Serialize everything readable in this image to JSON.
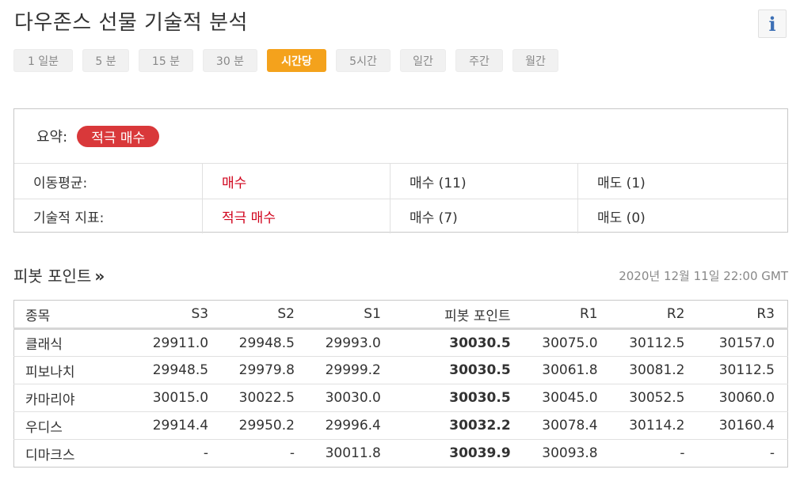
{
  "title": "다우존스 선물 기술적 분석",
  "info_icon": "info-icon",
  "timeframe_tabs": [
    {
      "label": "1 일분",
      "active": false
    },
    {
      "label": "5 분",
      "active": false
    },
    {
      "label": "15 분",
      "active": false
    },
    {
      "label": "30 분",
      "active": false
    },
    {
      "label": "시간당",
      "active": true
    },
    {
      "label": "5시간",
      "active": false
    },
    {
      "label": "일간",
      "active": false
    },
    {
      "label": "주간",
      "active": false
    },
    {
      "label": "월간",
      "active": false
    }
  ],
  "summary": {
    "label": "요약:",
    "badge": "적극 매수",
    "rows": [
      {
        "label": "이동평균:",
        "signal": "매수",
        "buy": "매수 (11)",
        "sell": "매도 (1)"
      },
      {
        "label": "기술적 지표:",
        "signal": "적극 매수",
        "buy": "매수 (7)",
        "sell": "매도 (0)"
      }
    ]
  },
  "pivot": {
    "title": "피봇 포인트",
    "arrow": "»",
    "timestamp": "2020년 12월 11일 22:00 GMT",
    "columns": [
      "종목",
      "S3",
      "S2",
      "S1",
      "피봇 포인트",
      "R1",
      "R2",
      "R3"
    ],
    "rows": [
      [
        "클래식",
        "29911.0",
        "29948.5",
        "29993.0",
        "30030.5",
        "30075.0",
        "30112.5",
        "30157.0"
      ],
      [
        "피보나치",
        "29948.5",
        "29979.8",
        "29999.2",
        "30030.5",
        "30061.8",
        "30081.2",
        "30112.5"
      ],
      [
        "카마리야",
        "30015.0",
        "30022.5",
        "30030.0",
        "30030.5",
        "30045.0",
        "30052.5",
        "30060.0"
      ],
      [
        "우디스",
        "29914.4",
        "29950.2",
        "29996.4",
        "30032.2",
        "30078.4",
        "30114.2",
        "30160.4"
      ],
      [
        "디마크스",
        "-",
        "-",
        "30011.8",
        "30039.9",
        "30093.8",
        "-",
        "-"
      ]
    ]
  },
  "colors": {
    "accent": "#f4a21c",
    "strong_buy": "#d9383a",
    "signal_text": "#d0021b",
    "info_icon": "#3c6fb5"
  }
}
